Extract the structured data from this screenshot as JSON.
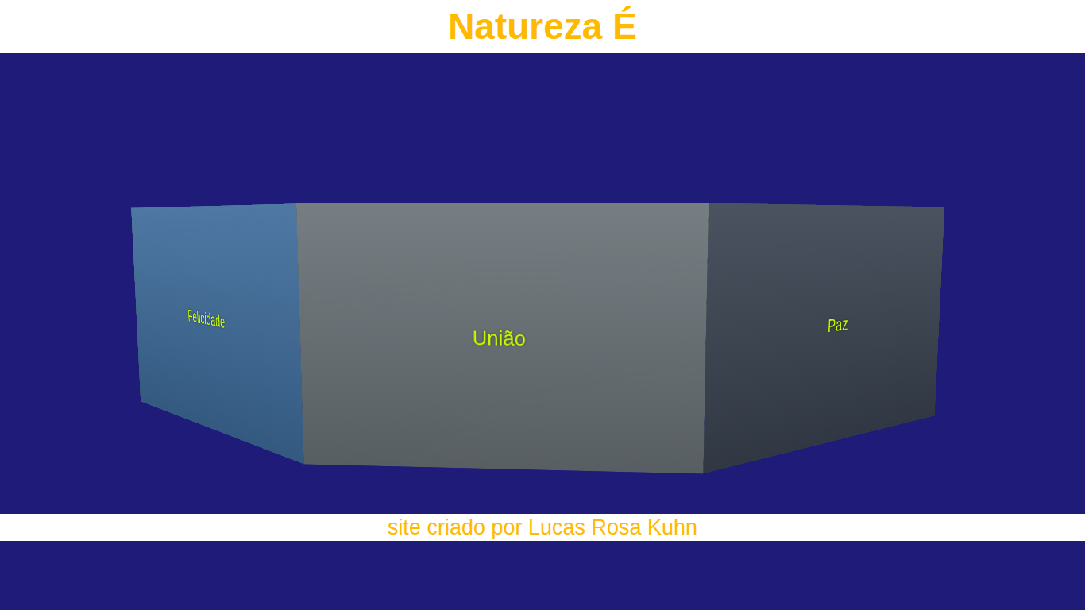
{
  "header": {
    "title": "Natureza É"
  },
  "carousel": {
    "cards": [
      {
        "caption": "União",
        "color": "#6b7378"
      },
      {
        "caption": "Paz",
        "color": "#3b4452"
      },
      {
        "color": "#3e2f2c"
      },
      {
        "color": "#6e5048"
      },
      {
        "color": "#55663c"
      },
      {
        "color": "#244d6c"
      },
      {
        "color": "#16364a"
      },
      {
        "color": "#2c3a28"
      },
      {
        "color": "#344a2c"
      },
      {
        "caption": "Felicidade",
        "color": "#3f6d9c"
      }
    ]
  },
  "footer": {
    "credit": "site criado por Lucas Rosa Kuhn"
  }
}
